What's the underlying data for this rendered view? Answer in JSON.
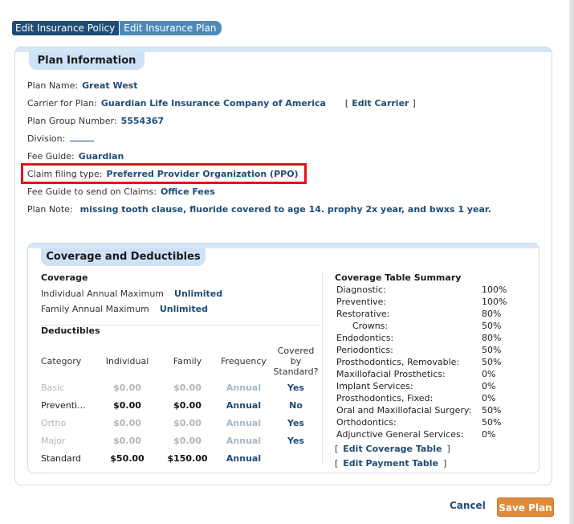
{
  "tabs": [
    {
      "label": "Edit Insurance Policy"
    },
    {
      "label": "Edit Insurance Plan"
    }
  ],
  "plan_info": {
    "title": "Plan Information",
    "plan_name_label": "Plan Name:",
    "plan_name": "Great West",
    "carrier_label": "Carrier for Plan:",
    "carrier": "Guardian Life Insurance Company of America",
    "edit_carrier": "Edit Carrier",
    "group_number_label": "Plan Group Number:",
    "group_number": "5554367",
    "division_label": "Division:",
    "fee_guide_label": "Fee Guide:",
    "fee_guide": "Guardian",
    "claim_type_label": "Claim filing type:",
    "claim_type": "Preferred Provider Organization (PPO)",
    "fee_guide_claims_label": "Fee Guide to send on Claims:",
    "fee_guide_claims": "Office Fees",
    "plan_note_label": "Plan Note:",
    "plan_note": "missing tooth clause, fluoride covered to age 14. prophy 2x year, and bwxs 1 year."
  },
  "coverage": {
    "title": "Coverage and Deductibles",
    "coverage_heading": "Coverage",
    "individual_max_label": "Individual Annual Maximum",
    "individual_max": "Unlimited",
    "family_max_label": "Family Annual Maximum",
    "family_max": "Unlimited",
    "deductibles_heading": "Deductibles",
    "table_headers": {
      "category": "Category",
      "individual": "Individual",
      "family": "Family",
      "frequency": "Frequency",
      "covered1": "Covered",
      "covered2": "by",
      "covered3": "Standard?"
    },
    "rows": [
      {
        "category": "Basic",
        "individual": "$0.00",
        "family": "$0.00",
        "frequency": "Annual",
        "covered": "Yes"
      },
      {
        "category": "Preventi...",
        "individual": "$0.00",
        "family": "$0.00",
        "frequency": "Annual",
        "covered": "No"
      },
      {
        "category": "Ortho",
        "individual": "$0.00",
        "family": "$0.00",
        "frequency": "Annual",
        "covered": "Yes"
      },
      {
        "category": "Major",
        "individual": "$0.00",
        "family": "$0.00",
        "frequency": "Annual",
        "covered": "Yes"
      },
      {
        "category": "Standard",
        "individual": "$50.00",
        "family": "$150.00",
        "frequency": "Annual",
        "covered": ""
      }
    ]
  },
  "summary": {
    "title": "Coverage Table Summary",
    "items": [
      {
        "name": "Diagnostic:",
        "pct": "100%"
      },
      {
        "name": "Preventive:",
        "pct": "100%"
      },
      {
        "name": "Restorative:",
        "pct": "80%"
      },
      {
        "name": "Crowns:",
        "pct": "50%"
      },
      {
        "name": "Endodontics:",
        "pct": "80%"
      },
      {
        "name": "Periodontics:",
        "pct": "50%"
      },
      {
        "name": "Prosthodontics, Removable:",
        "pct": "50%"
      },
      {
        "name": "Maxillofacial Prosthetics:",
        "pct": "0%"
      },
      {
        "name": "Implant Services:",
        "pct": "0%"
      },
      {
        "name": "Prosthodontics, Fixed:",
        "pct": "0%"
      },
      {
        "name": "Oral and Maxillofacial Surgery:",
        "pct": "50%"
      },
      {
        "name": "Orthodontics:",
        "pct": "50%"
      },
      {
        "name": "Adjunctive General Services:",
        "pct": "0%"
      }
    ],
    "edit_coverage": "Edit Coverage Table",
    "edit_payment": "Edit Payment Table"
  },
  "footer": {
    "cancel": "Cancel",
    "save": "Save Plan"
  },
  "colors": {
    "tab_dark": "#1f4c74",
    "tab_light": "#4e8ab8",
    "value_text": "#1f4c74",
    "section_header": "#cfe1f6",
    "highlight_box": "#e8101a",
    "save_button": "#e08a3a"
  }
}
